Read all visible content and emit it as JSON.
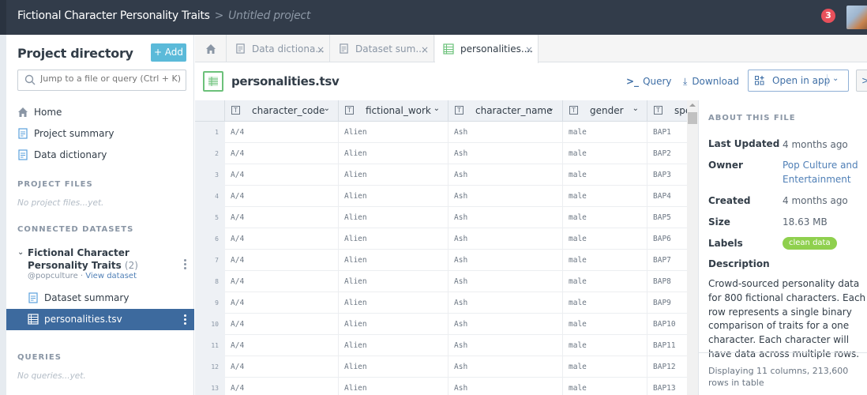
{
  "topbar": {
    "dataset_title": "Fictional Character Personality Traits",
    "separator": ">",
    "project_name": "Untitled project",
    "notification_count": "3"
  },
  "sidebar": {
    "title": "Project directory",
    "add_label": "+ Add",
    "search_placeholder": "Jump to a file or query (Ctrl + K)",
    "nav": [
      {
        "label": "Home",
        "icon": "home-icon"
      },
      {
        "label": "Project summary",
        "icon": "document-icon"
      },
      {
        "label": "Data dictionary",
        "icon": "document-icon"
      }
    ],
    "project_files_heading": "PROJECT FILES",
    "project_files_empty": "No project files...yet.",
    "connected_heading": "CONNECTED DATASETS",
    "dataset": {
      "title": "Fictional Character Personality Traits",
      "count": "(2)",
      "owner": "@popculture ·",
      "view_link": "View dataset",
      "items": [
        {
          "label": "Dataset summary",
          "icon": "document-icon"
        },
        {
          "label": "personalities.tsv",
          "icon": "table-icon",
          "selected": true
        }
      ]
    },
    "queries_heading": "QUERIES",
    "queries_empty": "No queries...yet."
  },
  "tabs": [
    {
      "label": "",
      "icon": "home-icon"
    },
    {
      "label": "Data dictiona...",
      "icon": "document-icon"
    },
    {
      "label": "Dataset sum...",
      "icon": "document-icon"
    },
    {
      "label": "personalities....",
      "icon": "table-icon",
      "active": true
    }
  ],
  "file": {
    "title": "personalities.tsv",
    "query_label": "Query",
    "download_label": "Download",
    "open_in_app_label": "Open in app"
  },
  "table": {
    "columns": [
      "character_code",
      "fictional_work",
      "character_name",
      "gender",
      "spe"
    ],
    "rows": [
      [
        "1",
        "A/4",
        "Alien",
        "Ash",
        "male",
        "BAP1"
      ],
      [
        "2",
        "A/4",
        "Alien",
        "Ash",
        "male",
        "BAP2"
      ],
      [
        "3",
        "A/4",
        "Alien",
        "Ash",
        "male",
        "BAP3"
      ],
      [
        "4",
        "A/4",
        "Alien",
        "Ash",
        "male",
        "BAP4"
      ],
      [
        "5",
        "A/4",
        "Alien",
        "Ash",
        "male",
        "BAP5"
      ],
      [
        "6",
        "A/4",
        "Alien",
        "Ash",
        "male",
        "BAP6"
      ],
      [
        "7",
        "A/4",
        "Alien",
        "Ash",
        "male",
        "BAP7"
      ],
      [
        "8",
        "A/4",
        "Alien",
        "Ash",
        "male",
        "BAP8"
      ],
      [
        "9",
        "A/4",
        "Alien",
        "Ash",
        "male",
        "BAP9"
      ],
      [
        "10",
        "A/4",
        "Alien",
        "Ash",
        "male",
        "BAP10"
      ],
      [
        "11",
        "A/4",
        "Alien",
        "Ash",
        "male",
        "BAP11"
      ],
      [
        "12",
        "A/4",
        "Alien",
        "Ash",
        "male",
        "BAP12"
      ],
      [
        "13",
        "A/4",
        "Alien",
        "Ash",
        "male",
        "BAP13"
      ]
    ]
  },
  "about": {
    "heading": "ABOUT THIS FILE",
    "last_updated_label": "Last Updated",
    "last_updated": "4 months ago",
    "owner_label": "Owner",
    "owner": "Pop Culture and Entertainment",
    "created_label": "Created",
    "created": "4 months ago",
    "size_label": "Size",
    "size": "18.63 MB",
    "labels_label": "Labels",
    "label_badge": "clean data",
    "description_label": "Description",
    "description": "Crowd-sourced personality data for 800 fictional characters. Each row represents a single binary comparison of traits for a one character. Each character will have data across multiple rows.",
    "footer": "Displaying 11 columns, 213,600 rows in table"
  },
  "colors": {
    "topbar_bg": "#323c4a",
    "accent_blue": "#3d6a9e",
    "add_button": "#5bbad9",
    "badge_green": "#8fd04e",
    "notification_red": "#e8505b",
    "table_icon_green": "#6cc17a"
  }
}
